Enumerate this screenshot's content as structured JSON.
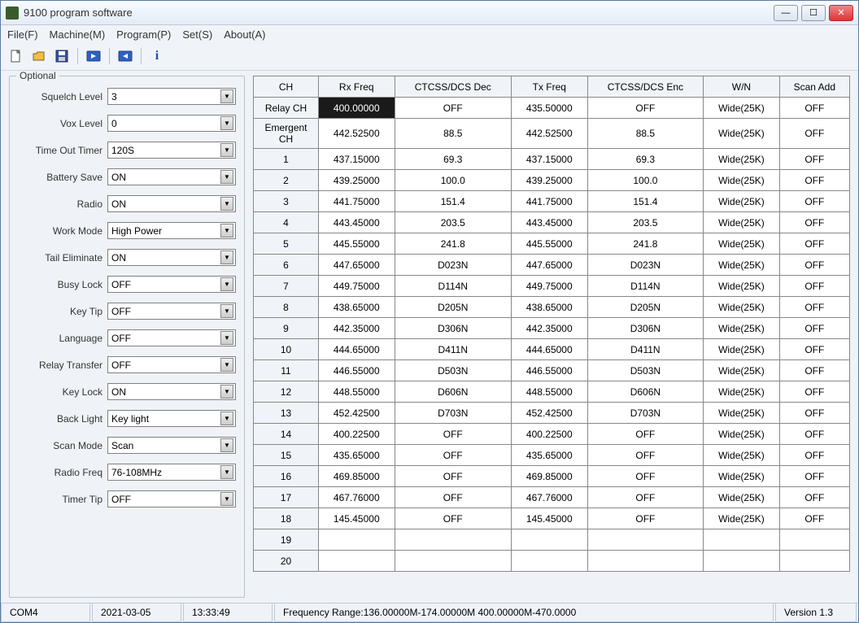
{
  "title": "9100 program software",
  "menu": [
    "File(F)",
    "Machine(M)",
    "Program(P)",
    "Set(S)",
    "About(A)"
  ],
  "optional": {
    "legend": "Optional",
    "fields": [
      {
        "label": "Squelch Level",
        "value": "3"
      },
      {
        "label": "Vox Level",
        "value": "0"
      },
      {
        "label": "Time Out Timer",
        "value": "120S"
      },
      {
        "label": "Battery Save",
        "value": "ON"
      },
      {
        "label": "Radio",
        "value": "ON"
      },
      {
        "label": "Work Mode",
        "value": "High Power"
      },
      {
        "label": "Tail Eliminate",
        "value": "ON"
      },
      {
        "label": "Busy Lock",
        "value": "OFF"
      },
      {
        "label": "Key Tip",
        "value": "OFF"
      },
      {
        "label": "Language",
        "value": "OFF"
      },
      {
        "label": "Relay Transfer",
        "value": "OFF"
      },
      {
        "label": "Key Lock",
        "value": "ON"
      },
      {
        "label": "Back Light",
        "value": "Key light"
      },
      {
        "label": "Scan Mode",
        "value": "Scan"
      },
      {
        "label": "Radio Freq",
        "value": "76-108MHz"
      },
      {
        "label": "Timer Tip",
        "value": "OFF"
      }
    ]
  },
  "grid": {
    "headers": [
      "CH",
      "Rx Freq",
      "CTCSS/DCS Dec",
      "Tx Freq",
      "CTCSS/DCS Enc",
      "W/N",
      "Scan Add"
    ],
    "rows": [
      {
        "ch": "Relay CH",
        "rx": "400.00000",
        "dec": "OFF",
        "tx": "435.50000",
        "enc": "OFF",
        "wn": "Wide(25K)",
        "scan": "OFF",
        "sel": true
      },
      {
        "ch": "Emergent CH",
        "rx": "442.52500",
        "dec": "88.5",
        "tx": "442.52500",
        "enc": "88.5",
        "wn": "Wide(25K)",
        "scan": "OFF"
      },
      {
        "ch": "1",
        "rx": "437.15000",
        "dec": "69.3",
        "tx": "437.15000",
        "enc": "69.3",
        "wn": "Wide(25K)",
        "scan": "OFF"
      },
      {
        "ch": "2",
        "rx": "439.25000",
        "dec": "100.0",
        "tx": "439.25000",
        "enc": "100.0",
        "wn": "Wide(25K)",
        "scan": "OFF"
      },
      {
        "ch": "3",
        "rx": "441.75000",
        "dec": "151.4",
        "tx": "441.75000",
        "enc": "151.4",
        "wn": "Wide(25K)",
        "scan": "OFF"
      },
      {
        "ch": "4",
        "rx": "443.45000",
        "dec": "203.5",
        "tx": "443.45000",
        "enc": "203.5",
        "wn": "Wide(25K)",
        "scan": "OFF"
      },
      {
        "ch": "5",
        "rx": "445.55000",
        "dec": "241.8",
        "tx": "445.55000",
        "enc": "241.8",
        "wn": "Wide(25K)",
        "scan": "OFF"
      },
      {
        "ch": "6",
        "rx": "447.65000",
        "dec": "D023N",
        "tx": "447.65000",
        "enc": "D023N",
        "wn": "Wide(25K)",
        "scan": "OFF"
      },
      {
        "ch": "7",
        "rx": "449.75000",
        "dec": "D114N",
        "tx": "449.75000",
        "enc": "D114N",
        "wn": "Wide(25K)",
        "scan": "OFF"
      },
      {
        "ch": "8",
        "rx": "438.65000",
        "dec": "D205N",
        "tx": "438.65000",
        "enc": "D205N",
        "wn": "Wide(25K)",
        "scan": "OFF"
      },
      {
        "ch": "9",
        "rx": "442.35000",
        "dec": "D306N",
        "tx": "442.35000",
        "enc": "D306N",
        "wn": "Wide(25K)",
        "scan": "OFF"
      },
      {
        "ch": "10",
        "rx": "444.65000",
        "dec": "D411N",
        "tx": "444.65000",
        "enc": "D411N",
        "wn": "Wide(25K)",
        "scan": "OFF"
      },
      {
        "ch": "11",
        "rx": "446.55000",
        "dec": "D503N",
        "tx": "446.55000",
        "enc": "D503N",
        "wn": "Wide(25K)",
        "scan": "OFF"
      },
      {
        "ch": "12",
        "rx": "448.55000",
        "dec": "D606N",
        "tx": "448.55000",
        "enc": "D606N",
        "wn": "Wide(25K)",
        "scan": "OFF"
      },
      {
        "ch": "13",
        "rx": "452.42500",
        "dec": "D703N",
        "tx": "452.42500",
        "enc": "D703N",
        "wn": "Wide(25K)",
        "scan": "OFF"
      },
      {
        "ch": "14",
        "rx": "400.22500",
        "dec": "OFF",
        "tx": "400.22500",
        "enc": "OFF",
        "wn": "Wide(25K)",
        "scan": "OFF"
      },
      {
        "ch": "15",
        "rx": "435.65000",
        "dec": "OFF",
        "tx": "435.65000",
        "enc": "OFF",
        "wn": "Wide(25K)",
        "scan": "OFF"
      },
      {
        "ch": "16",
        "rx": "469.85000",
        "dec": "OFF",
        "tx": "469.85000",
        "enc": "OFF",
        "wn": "Wide(25K)",
        "scan": "OFF"
      },
      {
        "ch": "17",
        "rx": "467.76000",
        "dec": "OFF",
        "tx": "467.76000",
        "enc": "OFF",
        "wn": "Wide(25K)",
        "scan": "OFF"
      },
      {
        "ch": "18",
        "rx": "145.45000",
        "dec": "OFF",
        "tx": "145.45000",
        "enc": "OFF",
        "wn": "Wide(25K)",
        "scan": "OFF"
      },
      {
        "ch": "19",
        "rx": "",
        "dec": "",
        "tx": "",
        "enc": "",
        "wn": "",
        "scan": ""
      },
      {
        "ch": "20",
        "rx": "",
        "dec": "",
        "tx": "",
        "enc": "",
        "wn": "",
        "scan": ""
      }
    ]
  },
  "status": {
    "port": "COM4",
    "date": "2021-03-05",
    "time": "13:33:49",
    "freq": "Frequency Range:136.00000M-174.00000M    400.00000M-470.0000",
    "version": "Version 1.3"
  }
}
